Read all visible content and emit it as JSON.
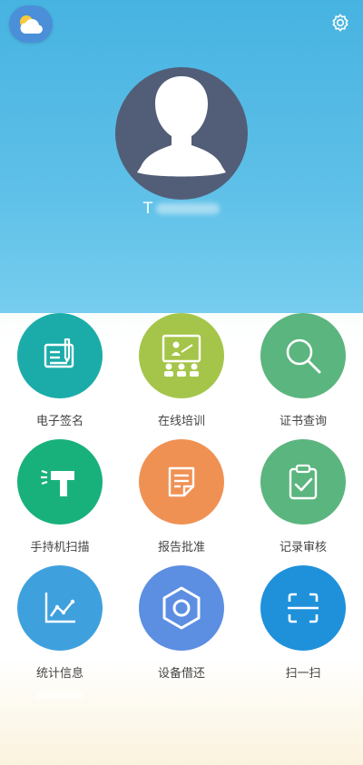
{
  "header": {
    "weather_icon": "weather-partly-cloudy-icon",
    "settings_icon": "gear-icon",
    "avatar_icon": "user-silhouette-icon",
    "username_prefix": "T"
  },
  "menu": [
    {
      "label": "电子签名",
      "icon": "signature-icon",
      "color": "#1bacaa"
    },
    {
      "label": "在线培训",
      "icon": "training-board-icon",
      "color": "#a5c54a"
    },
    {
      "label": "证书查询",
      "icon": "search-icon",
      "color": "#5bb57e"
    },
    {
      "label": "手持机扫描",
      "icon": "handheld-scanner-icon",
      "color": "#19b17b"
    },
    {
      "label": "报告批准",
      "icon": "report-note-icon",
      "color": "#f09154"
    },
    {
      "label": "记录审核",
      "icon": "clipboard-check-icon",
      "color": "#5bb57e"
    },
    {
      "label": "统计信息",
      "icon": "line-chart-icon",
      "color": "#3fa0de"
    },
    {
      "label": "设备借还",
      "icon": "hexagon-nut-icon",
      "color": "#5c8ee2"
    },
    {
      "label": "扫一扫",
      "icon": "scan-frame-icon",
      "color": "#1f91db"
    }
  ]
}
